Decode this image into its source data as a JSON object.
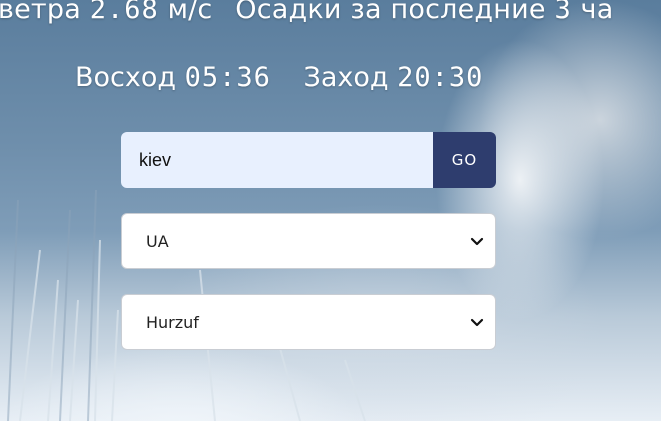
{
  "weather": {
    "wind_label": "ветра",
    "wind_value": "2.68",
    "wind_unit": "м/с",
    "precip_label": "Осадки за последние",
    "precip_value": "3",
    "precip_unit": "ча"
  },
  "sun": {
    "sunrise_label": "Восход",
    "sunrise_time": "05:36",
    "sunset_label": "Заход",
    "sunset_time": "20:30"
  },
  "search": {
    "city_value": "kiev",
    "go_label": "GO"
  },
  "country_select": {
    "selected": "UA"
  },
  "city_select": {
    "selected": "Hurzuf"
  },
  "icons": {
    "select_arrow": "chevron-down-icon"
  }
}
